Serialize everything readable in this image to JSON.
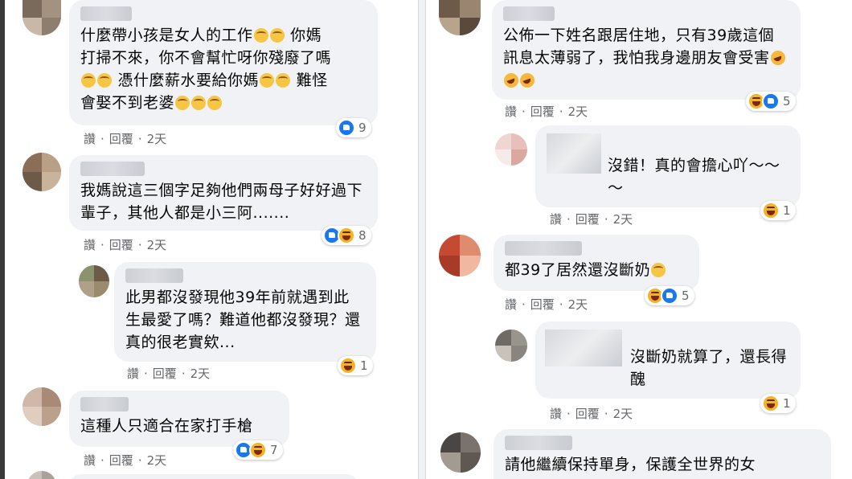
{
  "colors": {
    "bubble": "#f0f2f5",
    "meta": "#65676b",
    "like": "#1877f2",
    "haha": "#f7b125"
  },
  "actions": {
    "like": "讚",
    "reply": "回覆",
    "sep": "·"
  },
  "left": {
    "c1": {
      "text_a": "什麼帶小孩是女人的工作",
      "text_b": "你媽",
      "text_c": "打掃不來，你不會幫忙呀你殘廢了嗎",
      "text_d": "憑什麼薪水要給你媽",
      "text_e": "難怪",
      "text_f": "會娶不到老婆",
      "time": "2天",
      "count": "9",
      "reactions": [
        "like"
      ]
    },
    "c2": {
      "text": "我媽說這三個字足夠他們兩母子好好過下輩子，其他人都是小三阿.......",
      "time": "2天",
      "count": "8",
      "reactions": [
        "like",
        "haha"
      ]
    },
    "c3": {
      "text": "此男都沒發現他39年前就遇到此生最愛了嗎？難道他都沒發現？還真的很老實欸...",
      "time": "2天",
      "count": "1",
      "reactions": [
        "haha"
      ]
    },
    "c4": {
      "text": "這種人只適合在家打手槍",
      "time": "2天",
      "count": "7",
      "reactions": [
        "like",
        "haha"
      ]
    }
  },
  "right": {
    "c1": {
      "text_a": "公佈一下姓名跟居住地，只有39歲這個訊息太薄弱了，我怕我身邊朋友會受害",
      "time": "2天",
      "count": "5",
      "reactions": [
        "haha",
        "like"
      ]
    },
    "c2": {
      "text": "沒錯！真的會擔心吖～～～",
      "time": "2天",
      "count": "1",
      "reactions": [
        "haha"
      ]
    },
    "c3": {
      "text": "都39了居然還沒斷奶",
      "time": "2天",
      "count": "5",
      "reactions": [
        "haha",
        "like"
      ]
    },
    "c4": {
      "text": "沒斷奶就算了，還長得醜",
      "time": "2天",
      "count": "1",
      "reactions": [
        "haha"
      ]
    },
    "c5": {
      "text": "請他繼續保持單身，保護全世界的女"
    }
  }
}
